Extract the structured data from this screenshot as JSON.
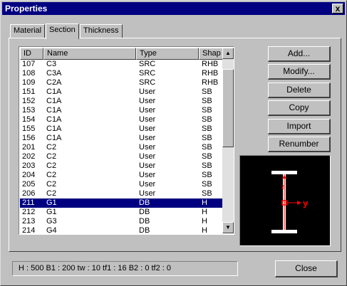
{
  "window": {
    "title": "Properties",
    "close_glyph": "x"
  },
  "tabs": [
    {
      "label": "Material",
      "active": false
    },
    {
      "label": "Section",
      "active": true
    },
    {
      "label": "Thickness",
      "active": false
    }
  ],
  "list": {
    "columns": [
      "ID",
      "Name",
      "Type",
      "Shap"
    ],
    "rows": [
      {
        "id": "107",
        "name": "C3",
        "type": "SRC",
        "shape": "RHB"
      },
      {
        "id": "108",
        "name": "C3A",
        "type": "SRC",
        "shape": "RHB"
      },
      {
        "id": "109",
        "name": "C2A",
        "type": "SRC",
        "shape": "RHB"
      },
      {
        "id": "151",
        "name": "C1A",
        "type": "User",
        "shape": "SB"
      },
      {
        "id": "152",
        "name": "C1A",
        "type": "User",
        "shape": "SB"
      },
      {
        "id": "153",
        "name": "C1A",
        "type": "User",
        "shape": "SB"
      },
      {
        "id": "154",
        "name": "C1A",
        "type": "User",
        "shape": "SB"
      },
      {
        "id": "155",
        "name": "C1A",
        "type": "User",
        "shape": "SB"
      },
      {
        "id": "156",
        "name": "C1A",
        "type": "User",
        "shape": "SB"
      },
      {
        "id": "201",
        "name": "C2",
        "type": "User",
        "shape": "SB"
      },
      {
        "id": "202",
        "name": "C2",
        "type": "User",
        "shape": "SB"
      },
      {
        "id": "203",
        "name": "C2",
        "type": "User",
        "shape": "SB"
      },
      {
        "id": "204",
        "name": "C2",
        "type": "User",
        "shape": "SB"
      },
      {
        "id": "205",
        "name": "C2",
        "type": "User",
        "shape": "SB"
      },
      {
        "id": "206",
        "name": "C2",
        "type": "User",
        "shape": "SB"
      },
      {
        "id": "211",
        "name": "G1",
        "type": "DB",
        "shape": "H",
        "selected": true
      },
      {
        "id": "212",
        "name": "G1",
        "type": "DB",
        "shape": "H"
      },
      {
        "id": "213",
        "name": "G3",
        "type": "DB",
        "shape": "H"
      },
      {
        "id": "214",
        "name": "G4",
        "type": "DB",
        "shape": "H"
      }
    ]
  },
  "buttons": {
    "add": "Add...",
    "modify": "Modify...",
    "delete": "Delete",
    "copy": "Copy",
    "import": "Import",
    "renumber": "Renumber"
  },
  "preview": {
    "axis_y_label": "y",
    "axis_z_label": "z",
    "section_color": "#ffffff",
    "axis_color": "#ff0000"
  },
  "status": {
    "text": "H : 500   B1 : 200   tw : 10   tf1 : 16   B2 : 0   tf2 : 0"
  },
  "close_button": "Close",
  "colors": {
    "face": "#c0c0c0",
    "titlebar": "#000080",
    "selection": "#000080"
  }
}
